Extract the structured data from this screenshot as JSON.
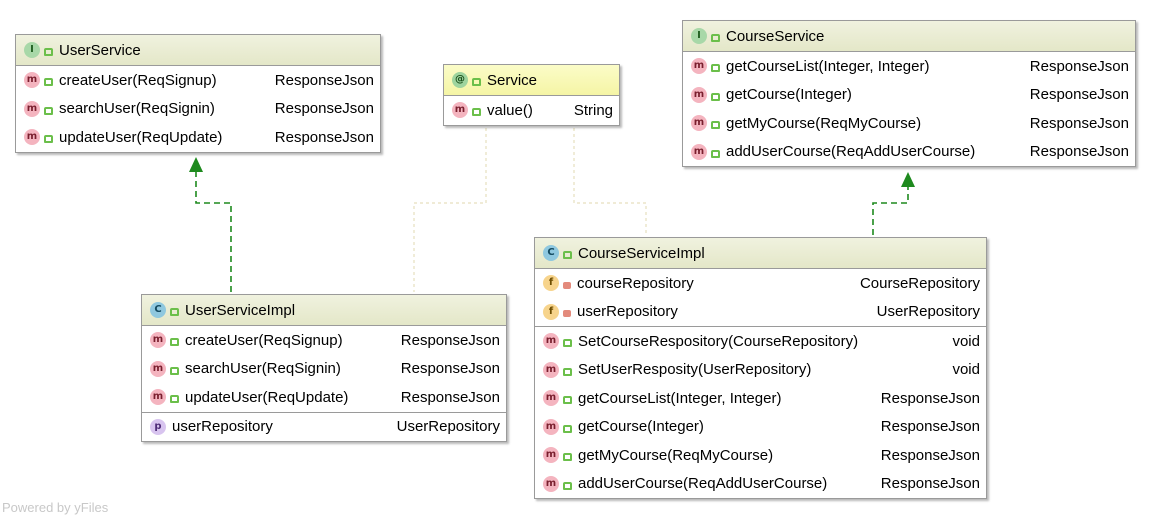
{
  "watermark": "Powered by yFiles",
  "userService": {
    "name": "UserService",
    "kind": "I",
    "methods": [
      {
        "name": "createUser(ReqSignup)",
        "type": "ResponseJson"
      },
      {
        "name": "searchUser(ReqSignin)",
        "type": "ResponseJson"
      },
      {
        "name": "updateUser(ReqUpdate)",
        "type": "ResponseJson"
      }
    ]
  },
  "service": {
    "name": "Service",
    "kind": "@",
    "methods": [
      {
        "name": "value()",
        "type": "String"
      }
    ]
  },
  "courseService": {
    "name": "CourseService",
    "kind": "I",
    "methods": [
      {
        "name": "getCourseList(Integer, Integer)",
        "type": "ResponseJson"
      },
      {
        "name": "getCourse(Integer)",
        "type": "ResponseJson"
      },
      {
        "name": "getMyCourse(ReqMyCourse)",
        "type": "ResponseJson"
      },
      {
        "name": "addUserCourse(ReqAddUserCourse)",
        "type": "ResponseJson"
      }
    ]
  },
  "userServiceImpl": {
    "name": "UserServiceImpl",
    "kind": "C",
    "methods": [
      {
        "name": "createUser(ReqSignup)",
        "type": "ResponseJson"
      },
      {
        "name": "searchUser(ReqSignin)",
        "type": "ResponseJson"
      },
      {
        "name": "updateUser(ReqUpdate)",
        "type": "ResponseJson"
      }
    ],
    "properties": [
      {
        "name": "userRepository",
        "type": "UserRepository"
      }
    ]
  },
  "courseServiceImpl": {
    "name": "CourseServiceImpl",
    "kind": "C",
    "fields": [
      {
        "name": "courseRepository",
        "type": "CourseRepository"
      },
      {
        "name": "userRepository",
        "type": "UserRepository"
      }
    ],
    "methods": [
      {
        "name": "SetCourseRespository(CourseRepository)",
        "type": "void"
      },
      {
        "name": "SetUserResposity(UserRepository)",
        "type": "void"
      },
      {
        "name": "getCourseList(Integer, Integer)",
        "type": "ResponseJson"
      },
      {
        "name": "getCourse(Integer)",
        "type": "ResponseJson"
      },
      {
        "name": "getMyCourse(ReqMyCourse)",
        "type": "ResponseJson"
      },
      {
        "name": "addUserCourse(ReqAddUserCourse)",
        "type": "ResponseJson"
      }
    ]
  },
  "colors": {
    "realization_arrow": "#1e8a1e",
    "annotation_link": "#e0d8b0"
  }
}
